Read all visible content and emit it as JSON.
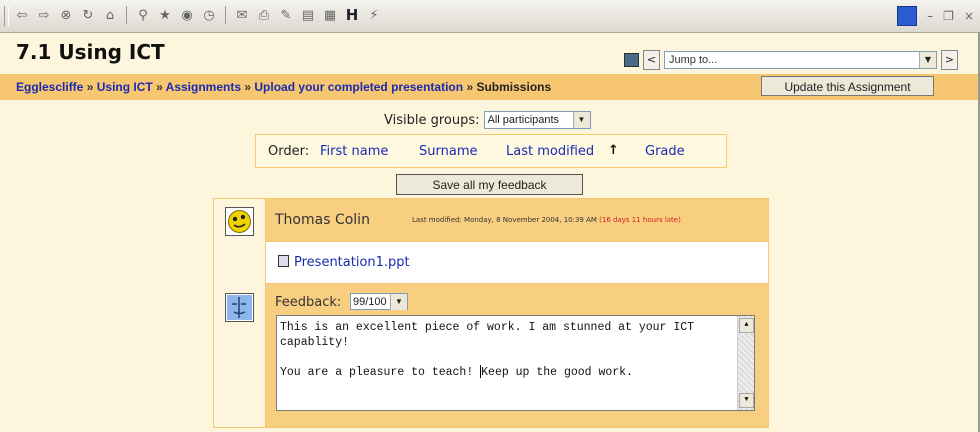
{
  "course": {
    "title": "7.1 Using ICT"
  },
  "jump": {
    "placeholder": "Jump to...",
    "prev": "<",
    "next": ">"
  },
  "breadcrumb": {
    "items": [
      "Egglescliffe",
      "Using ICT",
      "Assignments",
      "Upload your completed presentation"
    ],
    "separator": "»",
    "current": "Submissions"
  },
  "update_button": "Update this Assignment",
  "groups": {
    "label": "Visible groups:",
    "value": "All participants"
  },
  "order": {
    "label": "Order:",
    "links": [
      "First name",
      "Surname",
      "Last modified",
      "Grade"
    ],
    "sort_indicator": "↑"
  },
  "save_button": "Save all my feedback",
  "submission": {
    "student": "Thomas Colin",
    "modified_prefix": "Last modified: Monday, 8 November 2004, 10:39 AM",
    "late": "(16 days 11 hours late)",
    "file": "Presentation1.ppt",
    "feedback_label": "Feedback:",
    "grade": "99/100",
    "feedback_line1": "This is an excellent piece of work. I am stunned at your ICT capablity!",
    "feedback_line2a": "You are a pleasure to teach! ",
    "feedback_line2b": "Keep up the good work."
  },
  "colors": {
    "accent": "#f6c670",
    "link": "#1a2bb0",
    "late": "#cc2222",
    "background": "#fdf5dc"
  },
  "toolbar_icons": [
    "back-icon",
    "forward-icon",
    "stop-icon",
    "refresh-icon",
    "home-icon",
    "search-icon",
    "favorites-icon",
    "media-icon",
    "history-icon",
    "mail-icon",
    "print-icon",
    "edit-icon",
    "discuss-icon",
    "messenger-icon",
    "h-icon",
    "dev-icon"
  ]
}
